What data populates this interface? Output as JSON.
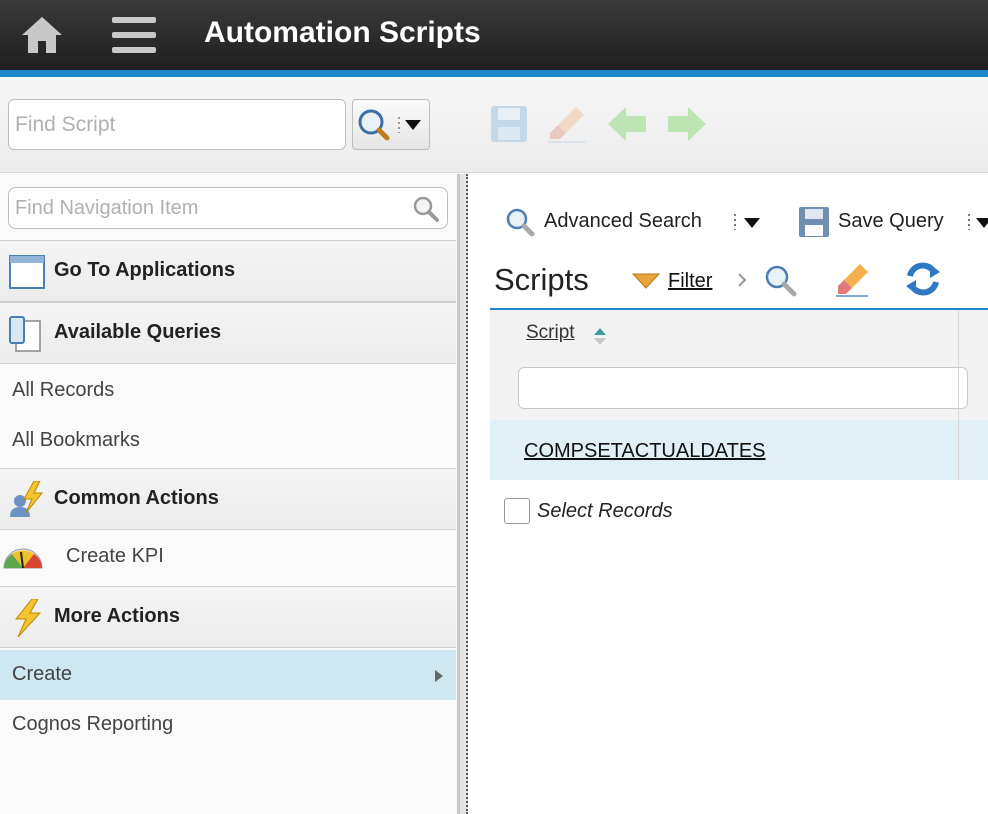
{
  "header": {
    "title": "Automation Scripts",
    "home_icon": "home-icon",
    "menu_icon": "hamburger-menu-icon"
  },
  "toolbar": {
    "find_script_placeholder": "Find Script",
    "search_icon": "magnifier-icon"
  },
  "leftnav": {
    "find_nav_placeholder": "Find Navigation Item",
    "sections": {
      "go_to_apps": "Go To Applications",
      "available_queries": "Available Queries",
      "common_actions": "Common Actions",
      "more_actions": "More Actions"
    },
    "items": {
      "all_records": "All Records",
      "all_bookmarks": "All Bookmarks",
      "create_kpi": "Create KPI",
      "create": "Create",
      "cognos": "Cognos Reporting"
    }
  },
  "content": {
    "advanced_search": "Advanced Search",
    "save_query": "Save Query",
    "list_title": "Scripts",
    "filter_label": "Filter",
    "column_header": "Script",
    "row_value": "COMPSETACTUALDATES",
    "select_records": "Select Records"
  },
  "colors": {
    "accent": "#1c87c9",
    "selected_row": "#e1f0f6",
    "selected_nav": "#cfe7f1"
  }
}
